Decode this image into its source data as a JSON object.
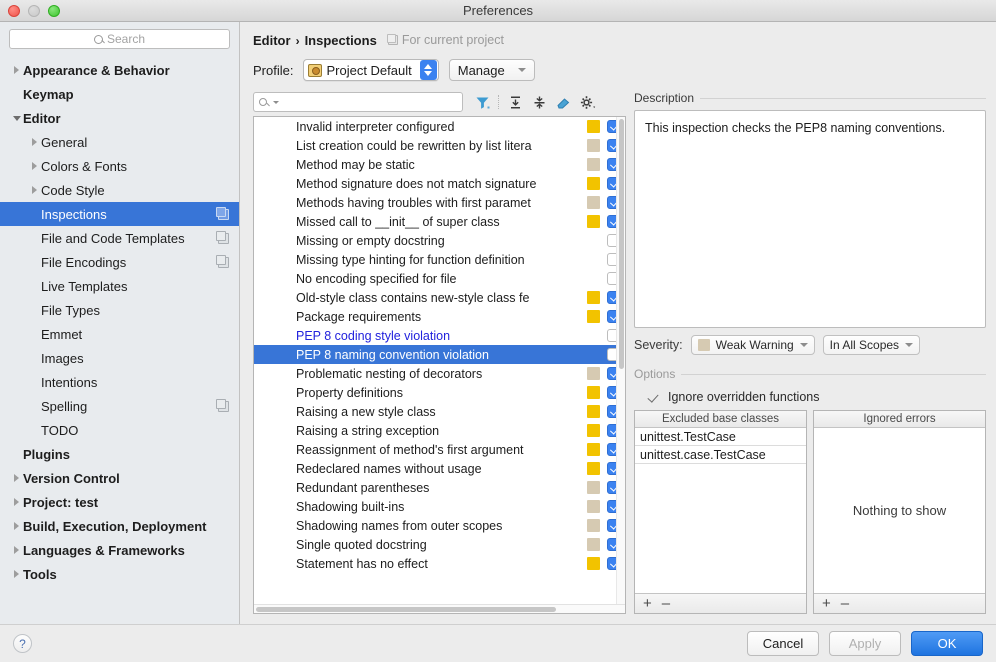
{
  "window": {
    "title": "Preferences"
  },
  "sidebar": {
    "search_placeholder": "Search",
    "items": [
      {
        "label": "Appearance & Behavior",
        "level": 0,
        "bold": true,
        "arrow": "right",
        "copy": false,
        "selected": false
      },
      {
        "label": "Keymap",
        "level": 0,
        "bold": true,
        "arrow": "none",
        "copy": false,
        "selected": false
      },
      {
        "label": "Editor",
        "level": 0,
        "bold": true,
        "arrow": "down",
        "copy": false,
        "selected": false
      },
      {
        "label": "General",
        "level": 1,
        "bold": false,
        "arrow": "right",
        "copy": false,
        "selected": false
      },
      {
        "label": "Colors & Fonts",
        "level": 1,
        "bold": false,
        "arrow": "right",
        "copy": false,
        "selected": false
      },
      {
        "label": "Code Style",
        "level": 1,
        "bold": false,
        "arrow": "right",
        "copy": false,
        "selected": false
      },
      {
        "label": "Inspections",
        "level": 1,
        "bold": false,
        "arrow": "none",
        "copy": true,
        "selected": true
      },
      {
        "label": "File and Code Templates",
        "level": 1,
        "bold": false,
        "arrow": "none",
        "copy": true,
        "selected": false
      },
      {
        "label": "File Encodings",
        "level": 1,
        "bold": false,
        "arrow": "none",
        "copy": true,
        "selected": false
      },
      {
        "label": "Live Templates",
        "level": 1,
        "bold": false,
        "arrow": "none",
        "copy": false,
        "selected": false
      },
      {
        "label": "File Types",
        "level": 1,
        "bold": false,
        "arrow": "none",
        "copy": false,
        "selected": false
      },
      {
        "label": "Emmet",
        "level": 1,
        "bold": false,
        "arrow": "none",
        "copy": false,
        "selected": false
      },
      {
        "label": "Images",
        "level": 1,
        "bold": false,
        "arrow": "none",
        "copy": false,
        "selected": false
      },
      {
        "label": "Intentions",
        "level": 1,
        "bold": false,
        "arrow": "none",
        "copy": false,
        "selected": false
      },
      {
        "label": "Spelling",
        "level": 1,
        "bold": false,
        "arrow": "none",
        "copy": true,
        "selected": false
      },
      {
        "label": "TODO",
        "level": 1,
        "bold": false,
        "arrow": "none",
        "copy": false,
        "selected": false
      },
      {
        "label": "Plugins",
        "level": 0,
        "bold": true,
        "arrow": "none",
        "copy": false,
        "selected": false
      },
      {
        "label": "Version Control",
        "level": 0,
        "bold": true,
        "arrow": "right",
        "copy": false,
        "selected": false
      },
      {
        "label": "Project: test",
        "level": 0,
        "bold": true,
        "arrow": "right",
        "copy": false,
        "selected": false
      },
      {
        "label": "Build, Execution, Deployment",
        "level": 0,
        "bold": true,
        "arrow": "right",
        "copy": false,
        "selected": false
      },
      {
        "label": "Languages & Frameworks",
        "level": 0,
        "bold": true,
        "arrow": "right",
        "copy": false,
        "selected": false
      },
      {
        "label": "Tools",
        "level": 0,
        "bold": true,
        "arrow": "right",
        "copy": false,
        "selected": false
      }
    ]
  },
  "breadcrumb": {
    "parent": "Editor",
    "separator": "›",
    "current": "Inspections",
    "note": "For current project"
  },
  "profile": {
    "label": "Profile:",
    "value": "Project Default",
    "manage_label": "Manage"
  },
  "filter": {
    "search_value": "",
    "icons": [
      "filter-icon",
      "expand-all-icon",
      "collapse-all-icon",
      "reset-icon",
      "settings-icon"
    ]
  },
  "inspections": [
    {
      "name": "Invalid interpreter configured",
      "severity": "warn",
      "checked": true,
      "selected": false,
      "blue": false
    },
    {
      "name": "List creation could be rewritten by list litera",
      "severity": "weak",
      "checked": true,
      "selected": false,
      "blue": false
    },
    {
      "name": "Method may be static",
      "severity": "weak",
      "checked": true,
      "selected": false,
      "blue": false
    },
    {
      "name": "Method signature does not match signature",
      "severity": "warn",
      "checked": true,
      "selected": false,
      "blue": false
    },
    {
      "name": "Methods having troubles with first paramet",
      "severity": "weak",
      "checked": true,
      "selected": false,
      "blue": false
    },
    {
      "name": "Missed call to __init__ of super class",
      "severity": "warn",
      "checked": true,
      "selected": false,
      "blue": false
    },
    {
      "name": "Missing or empty docstring",
      "severity": "none",
      "checked": false,
      "selected": false,
      "blue": false
    },
    {
      "name": "Missing type hinting for function definition",
      "severity": "none",
      "checked": false,
      "selected": false,
      "blue": false
    },
    {
      "name": "No encoding specified for file",
      "severity": "none",
      "checked": false,
      "selected": false,
      "blue": false
    },
    {
      "name": "Old-style class contains new-style class fe",
      "severity": "warn",
      "checked": true,
      "selected": false,
      "blue": false
    },
    {
      "name": "Package requirements",
      "severity": "warn",
      "checked": true,
      "selected": false,
      "blue": false
    },
    {
      "name": "PEP 8 coding style violation",
      "severity": "none",
      "checked": false,
      "selected": false,
      "blue": true
    },
    {
      "name": "PEP 8 naming convention violation",
      "severity": "none",
      "checked": false,
      "selected": true,
      "blue": true
    },
    {
      "name": "Problematic nesting of decorators",
      "severity": "weak",
      "checked": true,
      "selected": false,
      "blue": false
    },
    {
      "name": "Property definitions",
      "severity": "warn",
      "checked": true,
      "selected": false,
      "blue": false
    },
    {
      "name": "Raising a new style class",
      "severity": "warn",
      "checked": true,
      "selected": false,
      "blue": false
    },
    {
      "name": "Raising a string exception",
      "severity": "warn",
      "checked": true,
      "selected": false,
      "blue": false
    },
    {
      "name": "Reassignment of method's first argument",
      "severity": "warn",
      "checked": true,
      "selected": false,
      "blue": false
    },
    {
      "name": "Redeclared names without usage",
      "severity": "warn",
      "checked": true,
      "selected": false,
      "blue": false
    },
    {
      "name": "Redundant parentheses",
      "severity": "weak",
      "checked": true,
      "selected": false,
      "blue": false
    },
    {
      "name": "Shadowing built-ins",
      "severity": "weak",
      "checked": true,
      "selected": false,
      "blue": false
    },
    {
      "name": "Shadowing names from outer scopes",
      "severity": "weak",
      "checked": true,
      "selected": false,
      "blue": false
    },
    {
      "name": "Single quoted docstring",
      "severity": "weak",
      "checked": true,
      "selected": false,
      "blue": false
    },
    {
      "name": "Statement has no effect",
      "severity": "warn",
      "checked": true,
      "selected": false,
      "blue": false
    }
  ],
  "description": {
    "title": "Description",
    "text": "This inspection checks the PEP8 naming conventions."
  },
  "severity": {
    "label": "Severity:",
    "value": "Weak Warning",
    "swatch_color": "#d6cab2",
    "scope_value": "In All Scopes"
  },
  "options": {
    "title": "Options",
    "checkbox_label": "Ignore overridden functions",
    "checkbox_checked": true
  },
  "excluded_table": {
    "header": "Excluded base classes",
    "rows": [
      "unittest.TestCase",
      "unittest.case.TestCase"
    ],
    "add_label": "+",
    "remove_label": "–"
  },
  "ignored_table": {
    "header": "Ignored errors",
    "empty_text": "Nothing to show",
    "add_label": "+",
    "remove_label": "–"
  },
  "footer": {
    "help_label": "?",
    "cancel_label": "Cancel",
    "apply_label": "Apply",
    "ok_label": "OK"
  },
  "colors": {
    "selection": "#3875d7",
    "warning": "#f2c300",
    "weak_warning": "#d6cab2",
    "checkbox_on": "#3b82f0",
    "link_text": "#2222dd",
    "primary_button": "#1f74e0"
  }
}
